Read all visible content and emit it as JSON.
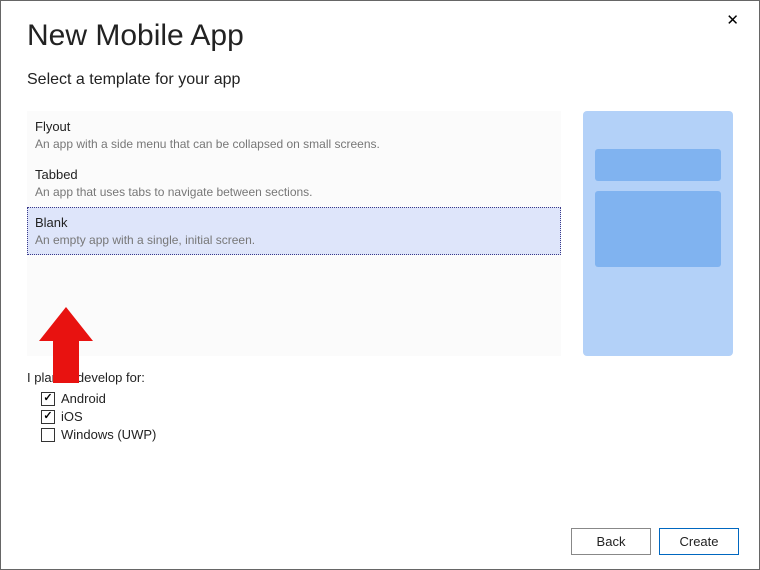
{
  "close_label": "✕",
  "title": "New Mobile App",
  "subtitle": "Select a template for your app",
  "templates": [
    {
      "title": "Flyout",
      "desc": "An app with a side menu that can be collapsed on small screens."
    },
    {
      "title": "Tabbed",
      "desc": "An app that uses tabs to navigate between sections."
    },
    {
      "title": "Blank",
      "desc": "An empty app with a single, initial screen."
    }
  ],
  "plan": {
    "label": "I plan to develop for:",
    "targets": [
      {
        "label": "Android",
        "checked": true
      },
      {
        "label": "iOS",
        "checked": true
      },
      {
        "label": "Windows (UWP)",
        "checked": false
      }
    ]
  },
  "buttons": {
    "back": "Back",
    "create": "Create"
  }
}
